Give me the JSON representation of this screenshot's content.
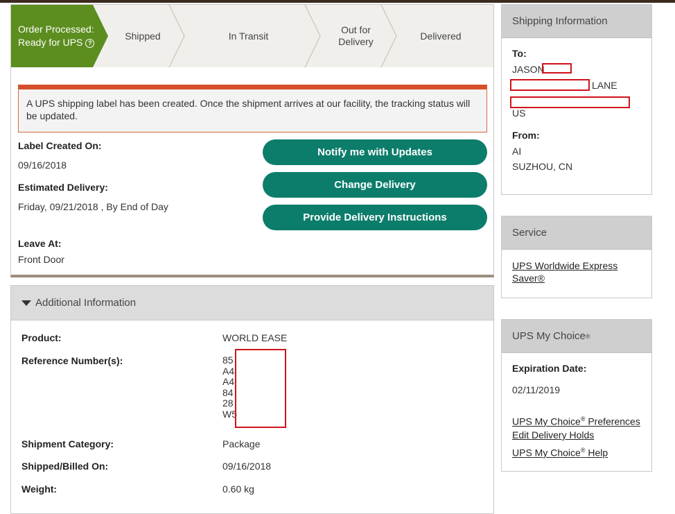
{
  "progress": {
    "active_line1": "Order Processed:",
    "active_line2": "Ready for UPS",
    "help_icon": "?",
    "steps": [
      "Shipped",
      "In Transit",
      "Out for",
      "Delivery",
      "Delivered"
    ]
  },
  "alert": {
    "text": "A UPS shipping label has been created. Once the shipment arrives at our facility, the tracking status will be updated."
  },
  "details": {
    "label_created_label": "Label Created On:",
    "label_created_value": "09/16/2018",
    "est_delivery_label": "Estimated Delivery:",
    "est_delivery_value": "Friday, 09/21/2018 , By End of Day",
    "leave_at_label": "Leave At:",
    "leave_at_value": "Front Door"
  },
  "buttons": {
    "notify": "Notify me with Updates",
    "change": "Change Delivery",
    "instructions": "Provide Delivery Instructions"
  },
  "additional": {
    "header": "Additional Information",
    "product_label": "Product:",
    "product_value": "WORLD EASE",
    "ref_label": "Reference Number(s):",
    "ref_values": [
      "85",
      "A4",
      "A4",
      "84",
      "28",
      "W5"
    ],
    "category_label": "Shipment Category:",
    "category_value": "Package",
    "shipped_label": "Shipped/Billed On:",
    "shipped_value": "09/16/2018",
    "weight_label": "Weight:",
    "weight_value": "0.60 kg"
  },
  "shipping_card": {
    "title": "Shipping Information",
    "to_label": "To:",
    "to_name": "JASON",
    "to_street": "LANE",
    "to_country": "US",
    "from_label": "From:",
    "from_name": "AI",
    "from_city": "SUZHOU,  CN"
  },
  "service_card": {
    "title": "Service",
    "link_line1": "UPS Worldwide Express",
    "link_line2": "Saver®"
  },
  "mychoice_card": {
    "title": "UPS My Choice",
    "title_sup": "®",
    "exp_label": "Expiration Date:",
    "exp_value": "02/11/2019",
    "pref_link_a": "UPS My Choice",
    "pref_link_sup": "®",
    "pref_link_b": " Preferences",
    "holds_link": "Edit Delivery Holds",
    "help_link_a": "UPS My Choice",
    "help_link_sup": "®",
    "help_link_b": " Help"
  },
  "colors": {
    "active_step": "#5c8d1f",
    "button": "#0c7d6b",
    "alert_bar": "#d5502a",
    "redaction": "#d0121b"
  }
}
